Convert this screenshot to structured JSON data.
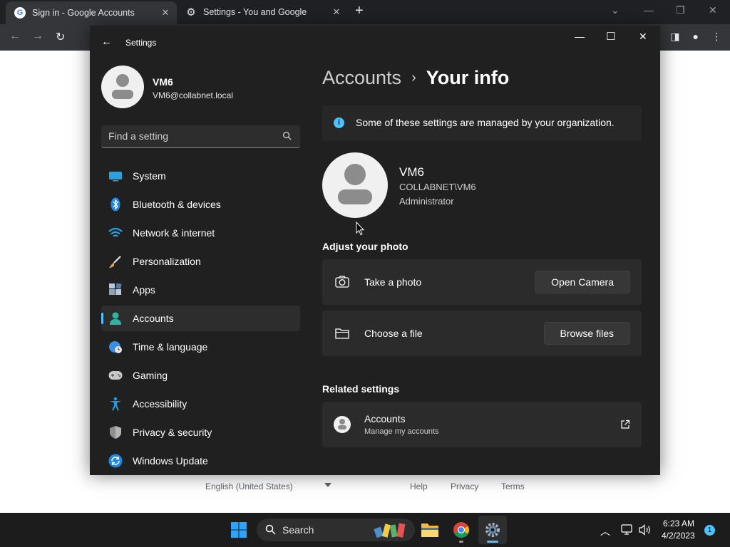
{
  "browser": {
    "tabs": [
      {
        "title": "Sign in - Google Accounts",
        "icon": "google-icon"
      },
      {
        "title": "Settings - You and Google",
        "icon": "gear-icon"
      }
    ],
    "footer": {
      "language": "English (United States)",
      "help": "Help",
      "privacy": "Privacy",
      "terms": "Terms"
    }
  },
  "settings": {
    "window_title": "Settings",
    "profile": {
      "name": "VM6",
      "email": "VM6@collabnet.local"
    },
    "search": {
      "placeholder": "Find a setting"
    },
    "nav": [
      {
        "label": "System",
        "icon": "system-icon"
      },
      {
        "label": "Bluetooth & devices",
        "icon": "bluetooth-icon"
      },
      {
        "label": "Network & internet",
        "icon": "wifi-icon"
      },
      {
        "label": "Personalization",
        "icon": "brush-icon"
      },
      {
        "label": "Apps",
        "icon": "apps-icon"
      },
      {
        "label": "Accounts",
        "icon": "person-icon",
        "selected": true
      },
      {
        "label": "Time & language",
        "icon": "clock-globe-icon"
      },
      {
        "label": "Gaming",
        "icon": "gamepad-icon"
      },
      {
        "label": "Accessibility",
        "icon": "accessibility-icon"
      },
      {
        "label": "Privacy & security",
        "icon": "shield-icon"
      },
      {
        "label": "Windows Update",
        "icon": "update-icon"
      }
    ],
    "breadcrumb": {
      "parent": "Accounts",
      "separator": "›",
      "current": "Your info"
    },
    "info_bar": {
      "text": "Some of these settings are managed by your organization."
    },
    "user": {
      "name": "VM6",
      "domain_user": "COLLABNET\\VM6",
      "role": "Administrator"
    },
    "adjust_photo": {
      "title": "Adjust your photo",
      "take_photo": {
        "label": "Take a photo",
        "button": "Open Camera"
      },
      "choose_file": {
        "label": "Choose a file",
        "button": "Browse files"
      }
    },
    "related": {
      "title": "Related settings",
      "accounts": {
        "title": "Accounts",
        "subtitle": "Manage my accounts"
      }
    }
  },
  "taskbar": {
    "search_label": "Search",
    "time": "6:23 AM",
    "date": "4/2/2023",
    "notification_count": "1"
  },
  "colors": {
    "accent": "#4cc2ff",
    "window_bg": "#202020",
    "card_bg": "#2b2b2b",
    "taskbar_bg": "#1c1c1c"
  }
}
